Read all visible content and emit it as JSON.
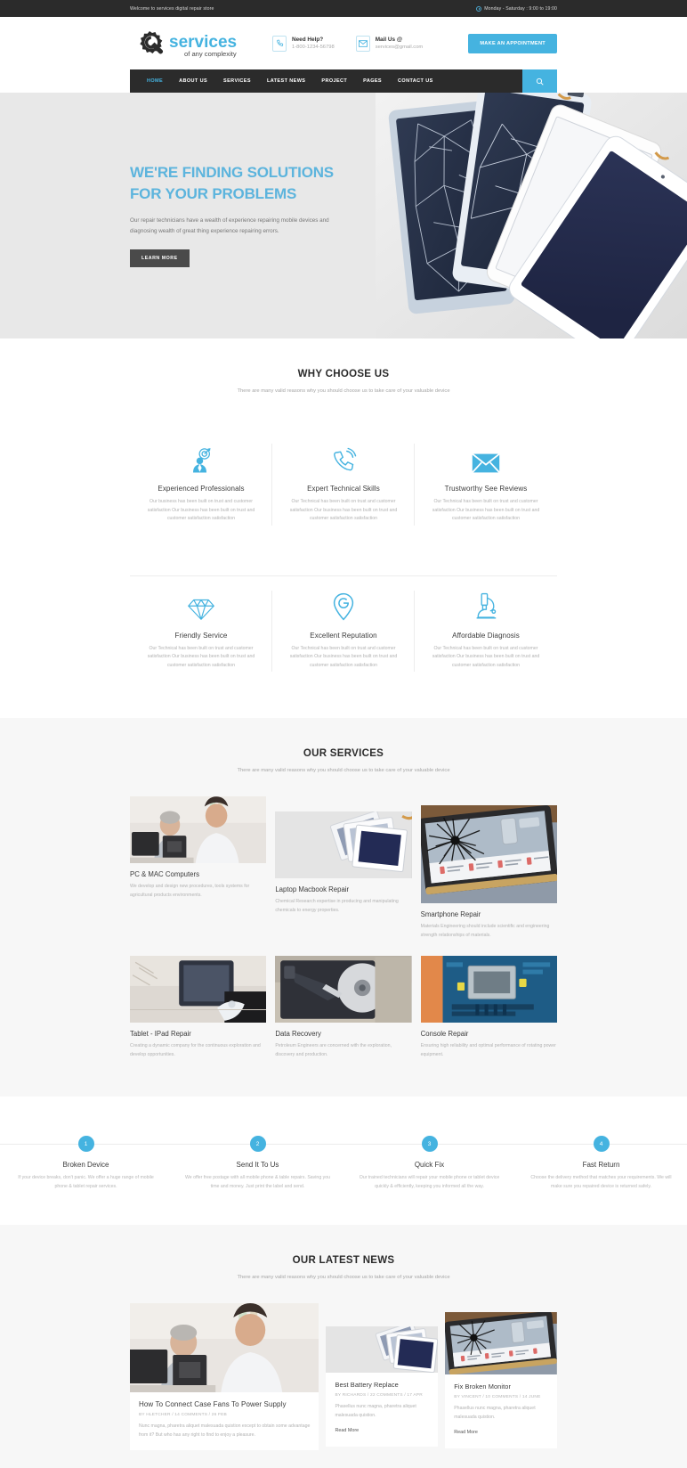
{
  "topbar": {
    "welcome": "Welcome to services digital repair store",
    "hours": "Monday - Saturday : 9:00 to 19:00",
    "clock_icon": "clock-icon"
  },
  "header": {
    "logo_main": "services",
    "logo_sub": "of any complexity",
    "phone_label": "Need Help?",
    "phone_value": "1-800-1234-56798",
    "mail_label": "Mail Us @",
    "mail_value": "services@gmail.com",
    "appointment_button": "MAKE AN APPOINTMENT",
    "phone_icon": "phone-icon",
    "mail_icon": "envelope-icon",
    "accent_color": "#45b3e0"
  },
  "nav": {
    "items": [
      {
        "label": "HOME",
        "active": true
      },
      {
        "label": "ABOUT US",
        "active": false
      },
      {
        "label": "SERVICES",
        "active": false
      },
      {
        "label": "LATEST NEWS",
        "active": false
      },
      {
        "label": "PROJECT",
        "active": false
      },
      {
        "label": "PAGES",
        "active": false
      },
      {
        "label": "CONTACT US",
        "active": false
      }
    ],
    "search_icon": "search-icon"
  },
  "hero": {
    "title_line1": "WE'RE FINDING SOLUTIONS",
    "title_line2": "FOR YOUR PROBLEMS",
    "paragraph": "Our repair technicians have a wealth of experience repairing mobile devices and diagnosing wealth of great thing experience repairing errors.",
    "button": "LEARN MORE",
    "title_color": "#5cb4dd",
    "background": "#e8e8e8"
  },
  "why_choose": {
    "title": "WHY CHOOSE US",
    "subtitle": "There are many valid reasons why you should choose us to take care of your valuable device",
    "features": [
      {
        "icon": "target-professional-icon",
        "title": "Experienced Professionals",
        "text": "Our business has been built on trust and customer satisfaction Our business has been built on trust and customer satisfaction satisfaction"
      },
      {
        "icon": "phone-ring-icon",
        "title": "Expert Technical Skills",
        "text": "Our Technical has been built on trust and customer satisfaction Our business has been built on trust and customer satisfaction satisfaction"
      },
      {
        "icon": "envelope-icon",
        "title": "Trustworthy See Reviews",
        "text": "Our Technical has been built on trust and customer satisfaction Our business has been built on trust and customer satisfaction satisfaction"
      },
      {
        "icon": "diamond-icon",
        "title": "Friendly Service",
        "text": "Our Technical has been built on trust and customer satisfaction Our business has been built on trust and customer satisfaction satisfaction"
      },
      {
        "icon": "location-pin-icon",
        "title": "Excellent Reputation",
        "text": "Our Technical has been built on trust and customer satisfaction Our business has been built on trust and customer satisfaction satisfaction"
      },
      {
        "icon": "microscope-icon",
        "title": "Affordable Diagnosis",
        "text": "Our Technical has been built on trust and customer satisfaction Our business has been built on trust and customer satisfaction satisfaction"
      }
    ]
  },
  "services": {
    "title": "OUR SERVICES",
    "subtitle": "There are many valid reasons why you should choose us to take care of your valuable device",
    "items": [
      {
        "image": "technicians-at-desktop-computer-photo",
        "title": "PC & MAC Computers",
        "text": "We develop and design new procedures, tools systems for agricultural products environments."
      },
      {
        "image": "stacked-laptop-screens-photo",
        "title": "Laptop Macbook Repair",
        "text": "Chemical Research expertise in producing and manipulating chemicals to energy properties."
      },
      {
        "image": "cracked-laptop-screen-photo",
        "title": "Smartphone Repair",
        "text": "Materials Engineering should include scientific and engineering strength relationships of materials."
      },
      {
        "image": "tablet-disassembly-tools-photo",
        "title": "Tablet - IPad Repair",
        "text": "Creating a dynamic company for the continuous exploration and develop opportunities."
      },
      {
        "image": "hard-drive-internals-photo",
        "title": "Data Recovery",
        "text": "Petroleum Engineers are concerned with the exploration, discovery and production."
      },
      {
        "image": "circuit-board-cpu-photo",
        "title": "Console Repair",
        "text": "Ensuring high reliability and optimal performance of rotating power equipment."
      }
    ]
  },
  "steps": [
    {
      "number": "1",
      "title": "Broken Device",
      "text": "If your device breaks, don't panic. We offer a huge range of mobile phone & tablet repair services."
    },
    {
      "number": "2",
      "title": "Send It To Us",
      "text": "We offer free postage with all mobile phone & table repairs. Saving you time and money. Just print the label and send."
    },
    {
      "number": "3",
      "title": "Quick Fix",
      "text": "Our trained technicians will repair your mobile phone or tablet device quickly & efficiently, keeping you informed all the way."
    },
    {
      "number": "4",
      "title": "Fast Return",
      "text": "Choose the delivery method that matches your requirements. We will make sure you repaired device is returned safely."
    }
  ],
  "news": {
    "title": "OUR LATEST NEWS",
    "subtitle": "There are many valid reasons why you should choose us to take care of your valuable device",
    "posts": [
      {
        "image": "technicians-at-desktop-computer-photo",
        "title": "How To Connect Case Fans To Power Supply",
        "meta": "BY HLETCHER / 14 COMMENTS / 26 FEB",
        "excerpt": "Nunc magna, pharetra aliquet malesuada quistion except to obtain some advantage from it? But who has any right to find to enjoy a pleasure.",
        "read_more": "Read More"
      },
      {
        "image": "stacked-laptop-screens-photo",
        "title": "Best Battery Replace",
        "meta": "BY RICHARDS / 22 COMMENTS / 17 APR",
        "excerpt": "Phasellus nunc magna, pharetra aliquet malesuada quistion.",
        "read_more": "Read More"
      },
      {
        "image": "cracked-laptop-screen-photo",
        "title": "Fix Broken Monitor",
        "meta": "BY VINCENT / 10 COMMENTS / 14 JUNE",
        "excerpt": "Phasellus nunc magna, pharetra aliquet malesuada quistion.",
        "read_more": "Read More"
      }
    ]
  }
}
